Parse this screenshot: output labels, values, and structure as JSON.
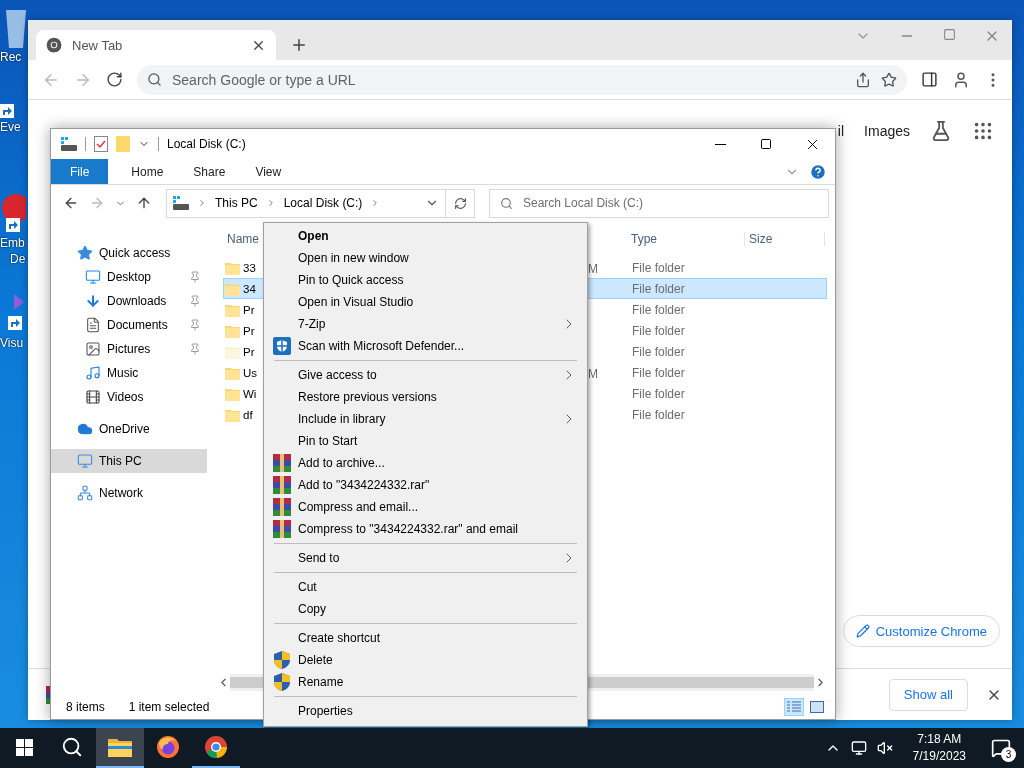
{
  "desktop": {
    "icons": [
      {
        "kind": "recycle",
        "lines": [
          "Rec"
        ]
      },
      {
        "kind": "shortcut",
        "lines": [
          "Eve"
        ]
      },
      {
        "kind": "red-app",
        "lines": [
          "Emb",
          "De"
        ]
      },
      {
        "kind": "purple-app",
        "lines": [
          "Visu"
        ]
      }
    ]
  },
  "browser": {
    "tab": {
      "title": "New Tab",
      "selected": true
    },
    "omnibox": {
      "placeholder": "Search Google or type a URL"
    },
    "header_links": [
      "il",
      "Images"
    ],
    "customize_button": "Customize Chrome",
    "download_bar": {
      "show_all": "Show all"
    }
  },
  "explorer": {
    "title": "Local Disk (C:)",
    "ribbon_tabs": [
      {
        "label": "File",
        "kind": "file"
      },
      {
        "label": "Home",
        "kind": "tab"
      },
      {
        "label": "Share",
        "kind": "tab"
      },
      {
        "label": "View",
        "kind": "tab"
      }
    ],
    "breadcrumbs": [
      "This PC",
      "Local Disk (C:)"
    ],
    "search": {
      "placeholder": "Search Local Disk (C:)"
    },
    "nav": [
      {
        "label": "Quick access",
        "kind": "star",
        "selected": false,
        "children": [
          {
            "label": "Desktop",
            "kind": "desktop",
            "pinned": true,
            "selected": false
          },
          {
            "label": "Downloads",
            "kind": "downloads",
            "pinned": true,
            "selected": false
          },
          {
            "label": "Documents",
            "kind": "documents",
            "pinned": true,
            "selected": false
          },
          {
            "label": "Pictures",
            "kind": "pictures",
            "pinned": true,
            "selected": false
          },
          {
            "label": "Music",
            "kind": "music",
            "pinned": false,
            "selected": false
          },
          {
            "label": "Videos",
            "kind": "videos",
            "pinned": false,
            "selected": false
          }
        ]
      },
      {
        "label": "OneDrive",
        "kind": "cloud",
        "selected": false
      },
      {
        "label": "This PC",
        "kind": "pc",
        "selected": true
      },
      {
        "label": "Network",
        "kind": "network",
        "selected": false
      }
    ],
    "columns": [
      "Name",
      "Type",
      "Size"
    ],
    "rows": [
      {
        "name": "33",
        "date": "M",
        "type": "File folder",
        "selected": false,
        "hidden": false
      },
      {
        "name": "34",
        "type": "File folder",
        "selected": true,
        "hidden": false
      },
      {
        "name": "Pr",
        "type": "File folder",
        "selected": false,
        "hidden": false
      },
      {
        "name": "Pr",
        "type": "File folder",
        "selected": false,
        "hidden": false
      },
      {
        "name": "Pr",
        "type": "File folder",
        "selected": false,
        "hidden": true
      },
      {
        "name": "Us",
        "date": "M",
        "type": "File folder",
        "selected": false,
        "hidden": false
      },
      {
        "name": "Wi",
        "type": "File folder",
        "selected": false,
        "hidden": false
      },
      {
        "name": "df",
        "type": "File folder",
        "selected": false,
        "hidden": false
      }
    ],
    "views": [
      {
        "kind": "details",
        "selected": true
      },
      {
        "kind": "tiles",
        "selected": false
      }
    ],
    "status": {
      "count": "8 items",
      "selection": "1 item selected"
    }
  },
  "context_menu": [
    {
      "kind": "plain",
      "label": "Open",
      "default": true,
      "submenu": false
    },
    {
      "kind": "plain",
      "label": "Open in new window",
      "default": false,
      "submenu": false
    },
    {
      "kind": "plain",
      "label": "Pin to Quick access",
      "default": false,
      "submenu": false
    },
    {
      "kind": "plain",
      "label": "Open in Visual Studio",
      "default": false,
      "submenu": false
    },
    {
      "kind": "plain",
      "label": "7-Zip",
      "default": false,
      "submenu": true
    },
    {
      "kind": "defender",
      "label": "Scan with Microsoft Defender...",
      "default": false,
      "submenu": false
    },
    {
      "kind": "separator"
    },
    {
      "kind": "plain",
      "label": "Give access to",
      "default": false,
      "submenu": true
    },
    {
      "kind": "plain",
      "label": "Restore previous versions",
      "default": false,
      "submenu": false
    },
    {
      "kind": "plain",
      "label": "Include in library",
      "default": false,
      "submenu": true
    },
    {
      "kind": "plain",
      "label": "Pin to Start",
      "default": false,
      "submenu": false
    },
    {
      "kind": "archive",
      "label": "Add to archive...",
      "default": false,
      "submenu": false
    },
    {
      "kind": "archive",
      "label": "Add to \"3434224332.rar\"",
      "default": false,
      "submenu": false
    },
    {
      "kind": "archive",
      "label": "Compress and email...",
      "default": false,
      "submenu": false
    },
    {
      "kind": "archive",
      "label": "Compress to \"3434224332.rar\" and email",
      "default": false,
      "submenu": false
    },
    {
      "kind": "separator"
    },
    {
      "kind": "plain",
      "label": "Send to",
      "default": false,
      "submenu": true
    },
    {
      "kind": "separator"
    },
    {
      "kind": "plain",
      "label": "Cut",
      "default": false,
      "submenu": false
    },
    {
      "kind": "plain",
      "label": "Copy",
      "default": false,
      "submenu": false
    },
    {
      "kind": "separator"
    },
    {
      "kind": "plain",
      "label": "Create shortcut",
      "default": false,
      "submenu": false
    },
    {
      "kind": "shield",
      "label": "Delete",
      "default": false,
      "submenu": false
    },
    {
      "kind": "shield",
      "label": "Rename",
      "default": false,
      "submenu": false
    },
    {
      "kind": "separator"
    },
    {
      "kind": "plain",
      "label": "Properties",
      "default": false,
      "submenu": false
    }
  ],
  "taskbar": {
    "apps": [
      {
        "kind": "explorer",
        "active": true,
        "running": true
      },
      {
        "kind": "firefox",
        "active": false,
        "running": false
      },
      {
        "kind": "chrome",
        "active": false,
        "running": true
      }
    ],
    "time": "7:18 AM",
    "date": "7/19/2023",
    "notifications": "3"
  }
}
